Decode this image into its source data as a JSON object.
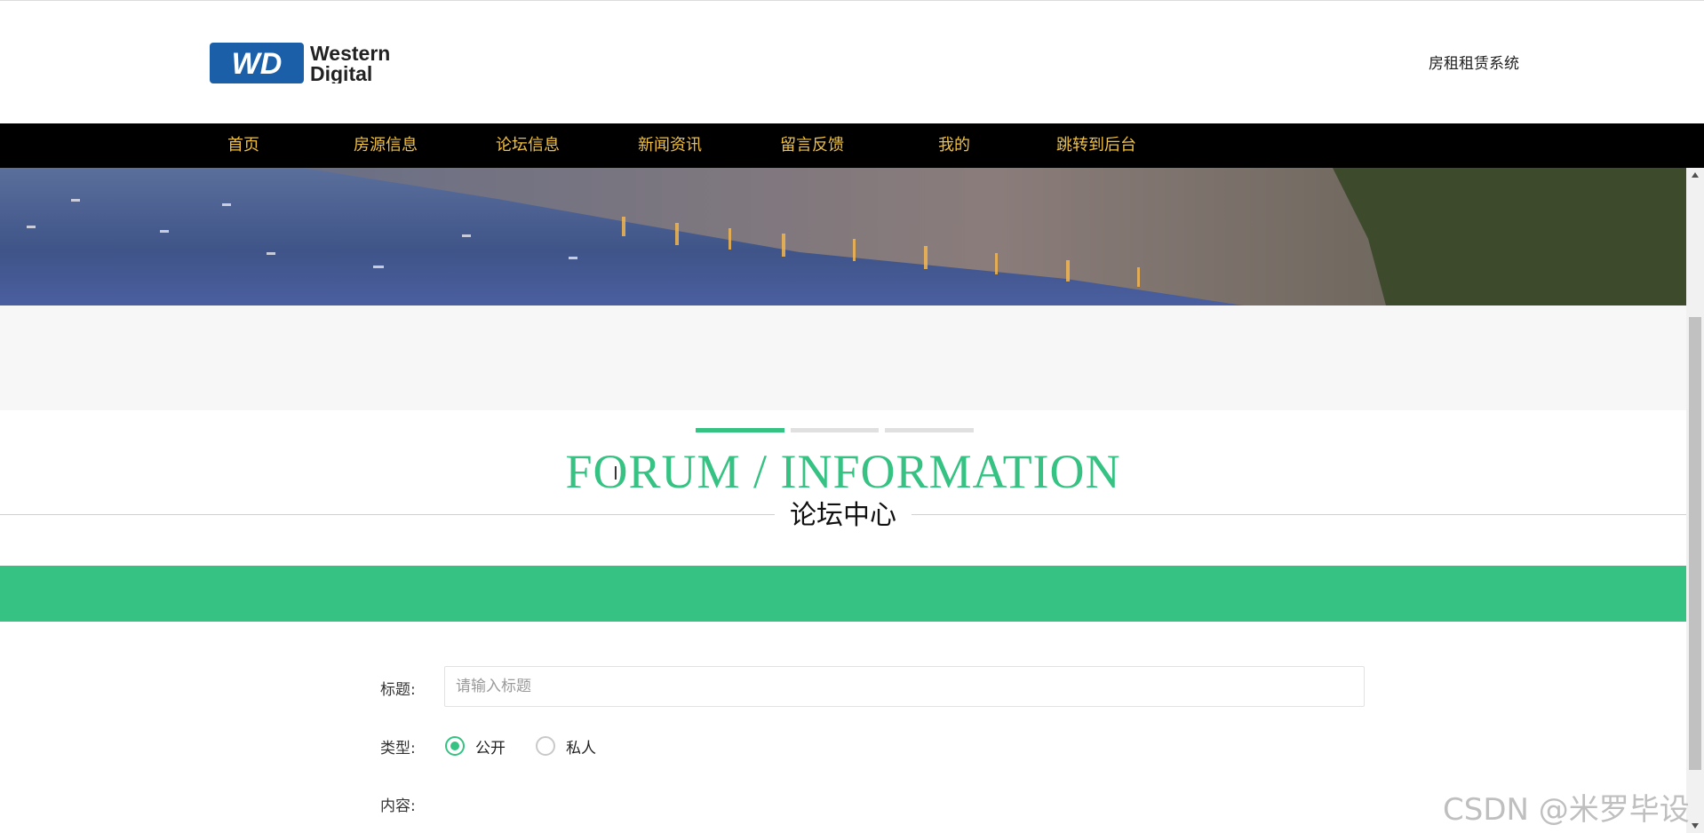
{
  "header": {
    "logo_line1": "Western",
    "logo_line2": "Digital",
    "logo_mark": "WD",
    "site_name": "房租租赁系统"
  },
  "nav": {
    "items": [
      {
        "label": "首页"
      },
      {
        "label": "房源信息"
      },
      {
        "label": "论坛信息"
      },
      {
        "label": "新闻资讯"
      },
      {
        "label": "留言反馈"
      },
      {
        "label": "我的"
      },
      {
        "label": "跳转到后台"
      }
    ]
  },
  "section": {
    "title_en": "FORUM / INFORMATION",
    "title_cn": "论坛中心"
  },
  "form": {
    "title_label": "标题:",
    "title_placeholder": "请输入标题",
    "title_value": "",
    "type_label": "类型:",
    "type_options": [
      {
        "label": "公开",
        "selected": true
      },
      {
        "label": "私人",
        "selected": false
      }
    ],
    "content_label": "内容:"
  },
  "watermark": "CSDN @米罗毕设",
  "colors": {
    "accent": "#35c282",
    "nav_bg": "#000000",
    "nav_text": "#f0c040"
  }
}
